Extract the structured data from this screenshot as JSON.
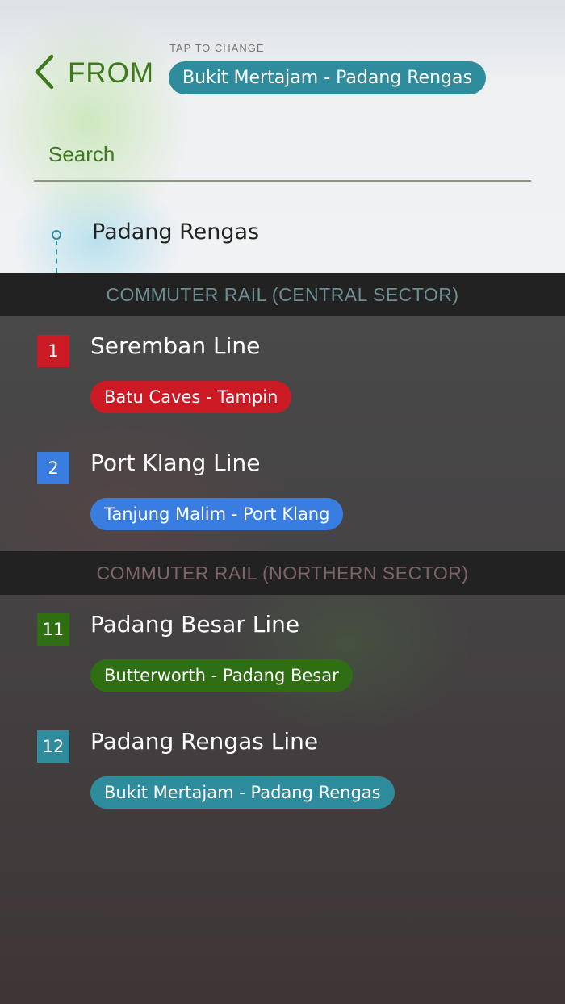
{
  "header": {
    "back_label": "FROM",
    "tap_hint": "TAP TO CHANGE",
    "selected_route": "Bukit Mertajam - Padang Rengas",
    "selected_route_color": "#2f8c9c",
    "accent_color": "#3d7a1c"
  },
  "search": {
    "placeholder": "Search",
    "value": ""
  },
  "station": {
    "name": "Padang Rengas",
    "icon": "station-dot-icon"
  },
  "sections": [
    {
      "title": "COMMUTER RAIL (CENTRAL SECTOR)",
      "title_color": "#6d8f93",
      "lines": [
        {
          "number": "1",
          "name": "Seremban Line",
          "route": "Batu Caves - Tampin",
          "color": "#cc1a24"
        },
        {
          "number": "2",
          "name": "Port Klang Line",
          "route": "Tanjung Malim - Port Klang",
          "color": "#3a7de0"
        }
      ]
    },
    {
      "title": "COMMUTER RAIL (NORTHERN SECTOR)",
      "title_color": "#7d6467",
      "lines": [
        {
          "number": "11",
          "name": "Padang Besar Line",
          "route": "Butterworth - Padang Besar",
          "color": "#2f6e12"
        },
        {
          "number": "12",
          "name": "Padang Rengas Line",
          "route": "Bukit Mertajam - Padang Rengas",
          "color": "#2f8c9c"
        }
      ]
    }
  ]
}
